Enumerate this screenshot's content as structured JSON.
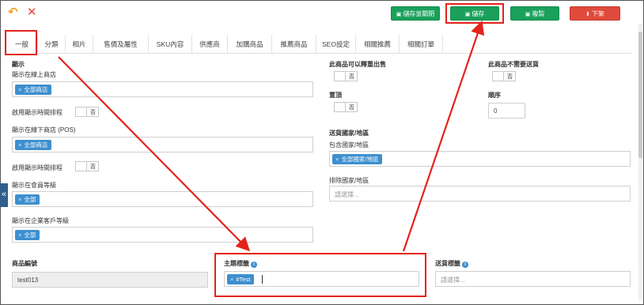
{
  "toolbar": {
    "back_icon": "↶",
    "close_icon": "✕",
    "buttons": {
      "save_close": "儲存並關閉",
      "save": "儲存",
      "copy": "複製",
      "pull_down": "下架"
    }
  },
  "tabs": [
    {
      "label": "一般"
    },
    {
      "label": "分類"
    },
    {
      "label": "相片"
    },
    {
      "label": "售價及屬性"
    },
    {
      "label": "SKU內容"
    },
    {
      "label": "供應商"
    },
    {
      "label": "加購商品"
    },
    {
      "label": "推薦商品"
    },
    {
      "label": "SEO設定"
    },
    {
      "label": "相關推薦"
    },
    {
      "label": "相關訂單"
    }
  ],
  "left": {
    "section": "顯示",
    "online_store_label": "顯示在線上商店",
    "online_store_chip": "全部商店",
    "schedule_label_1": "啟用顯示時間排程",
    "schedule_toggle_1": "否",
    "pos_label": "顯示在線下商店 (POS)",
    "pos_chip": "全部商店",
    "schedule_label_2": "啟用顯示時間排程",
    "schedule_toggle_2": "否",
    "member_label": "顯示在會員等級",
    "member_chip": "全部",
    "enterprise_label": "顯示在企業客戶等級",
    "enterprise_chip": "全部"
  },
  "right": {
    "resell_label": "此商品可以釋重出售",
    "resell_toggle": "否",
    "no_shipping_label": "此商品不需要送貨",
    "no_shipping_toggle": "否",
    "pin_label": "置頂",
    "pin_toggle": "否",
    "order_label": "順序",
    "order_value": "0",
    "shipping_region_label": "送貨國家/地區",
    "include_label": "包含國家/地區",
    "include_chip": "全部國家/地區",
    "exclude_label": "排除國家/地區",
    "exclude_placeholder": "請選擇..."
  },
  "bottom": {
    "product_code_label": "商品編號",
    "product_code_value": "test013",
    "tag_label": "主題標籤",
    "tag_chip": "#Test",
    "shipping_tag_label": "送貨標籤",
    "shipping_tag_placeholder": "請選擇..."
  },
  "colors": {
    "green": "#1aa05a",
    "red": "#e04a3c",
    "chip_blue": "#3d8fcf",
    "annotation_red": "#e3231b",
    "back_icon": "#f0a020",
    "close_icon": "#e04a3c"
  }
}
